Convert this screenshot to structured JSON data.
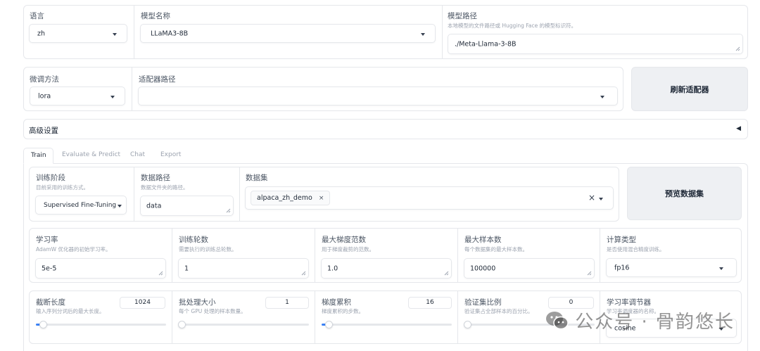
{
  "top": {
    "language": {
      "label": "语言",
      "value": "zh"
    },
    "model_name": {
      "label": "模型名称",
      "value": "LLaMA3-8B"
    },
    "model_path": {
      "label": "模型路径",
      "info": "本地模型的文件路径或 Hugging Face 的模型标识符。",
      "value": "./Meta-Llama-3-8B"
    }
  },
  "second": {
    "finetune": {
      "label": "微调方法",
      "value": "lora"
    },
    "adapter": {
      "label": "适配器路径",
      "value": ""
    },
    "refresh_button": "刷新适配器"
  },
  "advanced": {
    "label": "高级设置",
    "arrow": "◀"
  },
  "tabs": [
    {
      "label": "Train",
      "active": true
    },
    {
      "label": "Evaluate & Predict",
      "active": false
    },
    {
      "label": "Chat",
      "active": false
    },
    {
      "label": "Export",
      "active": false
    }
  ],
  "train": {
    "stage": {
      "label": "训练阶段",
      "info": "目前采用的训练方式。",
      "value": "Supervised Fine-Tuning"
    },
    "dataset_dir": {
      "label": "数据路径",
      "info": "数据文件夹的路径。",
      "value": "data"
    },
    "dataset": {
      "label": "数据集",
      "chip": "alpaca_zh_demo",
      "chip_remove": "×",
      "clear": "×"
    },
    "preview_button": "预览数据集",
    "learning_rate": {
      "label": "学习率",
      "info": "AdamW 优化器的初始学习率。",
      "value": "5e-5"
    },
    "epochs": {
      "label": "训练轮数",
      "info": "需要执行的训练总轮数。",
      "value": "1"
    },
    "max_grad_norm": {
      "label": "最大梯度范数",
      "info": "用于梯度裁剪的范数。",
      "value": "1.0"
    },
    "max_samples": {
      "label": "最大样本数",
      "info": "每个数据集的最大样本数。",
      "value": "100000"
    },
    "compute_type": {
      "label": "计算类型",
      "info": "是否使用混合精度训练。",
      "value": "fp16"
    },
    "cutoff_len": {
      "label": "截断长度",
      "info": "输入序列分词后的最大长度。",
      "value": "1024",
      "fraction": 0.03
    },
    "batch_size": {
      "label": "批处理大小",
      "info": "每个 GPU 处理的样本数量。",
      "value": "1",
      "fraction": 0.0
    },
    "grad_accum": {
      "label": "梯度累积",
      "info": "梯度累积的步数。",
      "value": "16",
      "fraction": 0.03
    },
    "val_size": {
      "label": "验证集比例",
      "info": "验证集占全部样本的百分比。",
      "value": "0",
      "fraction": 0.0
    },
    "lr_scheduler": {
      "label": "学习率调节器",
      "info": "学习率调度器的名称。",
      "value": "cosine"
    }
  },
  "watermark": "公众号 · 骨韵悠长",
  "colors": {
    "accent": "#3b82f6",
    "border": "#e5e7eb",
    "button_bg": "#eef0f3"
  }
}
